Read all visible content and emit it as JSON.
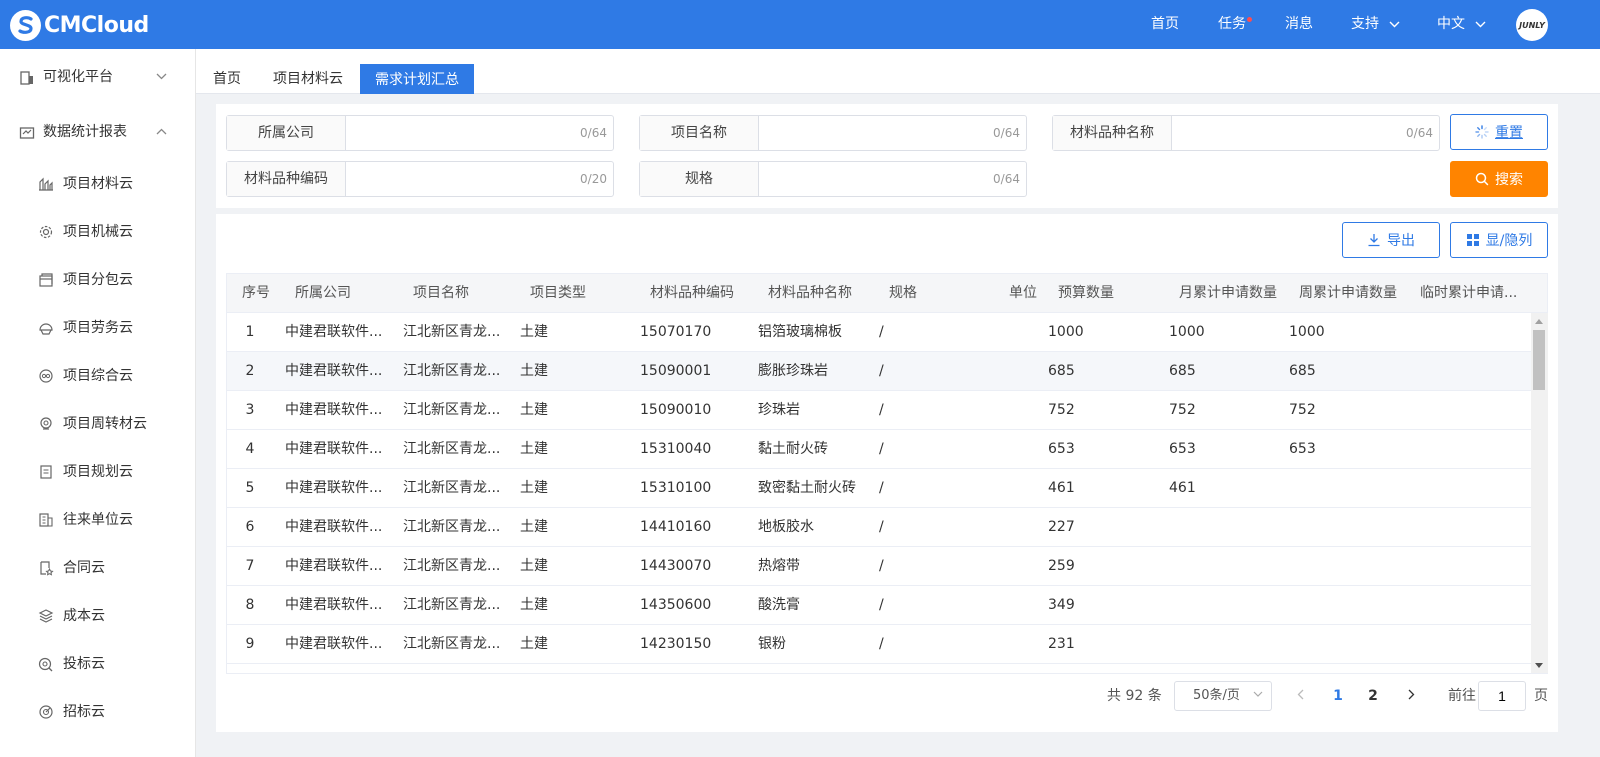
{
  "brand": {
    "logo_text": "CMCloud"
  },
  "header": {
    "nav": [
      "首页",
      "任务",
      "消息",
      "支持",
      "中文"
    ],
    "avatar_text": "JUNLY"
  },
  "sidebar": {
    "groups": [
      {
        "label": "可视化平台",
        "icon": "building-icon",
        "expanded": false
      },
      {
        "label": "数据统计报表",
        "icon": "report-icon",
        "expanded": true
      }
    ],
    "items": [
      {
        "label": "项目材料云",
        "icon": "chart-icon"
      },
      {
        "label": "项目机械云",
        "icon": "gear-icon"
      },
      {
        "label": "项目分包云",
        "icon": "package-icon"
      },
      {
        "label": "项目劳务云",
        "icon": "helmet-icon"
      },
      {
        "label": "项目综合云",
        "icon": "coins-icon"
      },
      {
        "label": "项目周转材云",
        "icon": "cycle-icon"
      },
      {
        "label": "项目规划云",
        "icon": "plan-icon"
      },
      {
        "label": "往来单位云",
        "icon": "office-icon"
      },
      {
        "label": "合同云",
        "icon": "contract-icon"
      },
      {
        "label": "成本云",
        "icon": "layers-icon"
      },
      {
        "label": "投标云",
        "icon": "bid-icon"
      },
      {
        "label": "招标云",
        "icon": "target-icon"
      }
    ]
  },
  "tabs": [
    {
      "label": "首页",
      "active": false
    },
    {
      "label": "项目材料云",
      "active": false
    },
    {
      "label": "需求计划汇总",
      "active": true
    }
  ],
  "filters": {
    "fields": [
      {
        "label": "所属公司",
        "value": "",
        "count": "0/64"
      },
      {
        "label": "项目名称",
        "value": "",
        "count": "0/64"
      },
      {
        "label": "材料品种名称",
        "value": "",
        "count": "0/64"
      },
      {
        "label": "材料品种编码",
        "value": "",
        "count": "0/20"
      },
      {
        "label": "规格",
        "value": "",
        "count": "0/64"
      }
    ],
    "reset_label": "重置",
    "search_label": "搜索"
  },
  "toolbar": {
    "export_label": "导出",
    "columns_label": "显/隐列"
  },
  "table": {
    "columns": [
      "序号",
      "所属公司",
      "项目名称",
      "项目类型",
      "材料品种编码",
      "材料品种名称",
      "规格",
      "单位",
      "预算数量",
      "月累计申请数量",
      "周累计申请数量",
      "临时累计申请..."
    ],
    "rows": [
      [
        "1",
        "中建君联软件...",
        "江北新区青龙...",
        "土建",
        "15070170",
        "铝箔玻璃棉板",
        "/",
        "",
        "1000",
        "1000",
        "1000",
        ""
      ],
      [
        "2",
        "中建君联软件...",
        "江北新区青龙...",
        "土建",
        "15090001",
        "膨胀珍珠岩",
        "/",
        "",
        "685",
        "685",
        "685",
        ""
      ],
      [
        "3",
        "中建君联软件...",
        "江北新区青龙...",
        "土建",
        "15090010",
        "珍珠岩",
        "/",
        "",
        "752",
        "752",
        "752",
        ""
      ],
      [
        "4",
        "中建君联软件...",
        "江北新区青龙...",
        "土建",
        "15310040",
        "黏土耐火砖",
        "/",
        "",
        "653",
        "653",
        "653",
        ""
      ],
      [
        "5",
        "中建君联软件...",
        "江北新区青龙...",
        "土建",
        "15310100",
        "致密黏土耐火砖",
        "/",
        "",
        "461",
        "461",
        "",
        ""
      ],
      [
        "6",
        "中建君联软件...",
        "江北新区青龙...",
        "土建",
        "14410160",
        "地板胶水",
        "/",
        "",
        "227",
        "",
        "",
        ""
      ],
      [
        "7",
        "中建君联软件...",
        "江北新区青龙...",
        "土建",
        "14430070",
        "热熔带",
        "/",
        "",
        "259",
        "",
        "",
        ""
      ],
      [
        "8",
        "中建君联软件...",
        "江北新区青龙...",
        "土建",
        "14350600",
        "酸洗膏",
        "/",
        "",
        "349",
        "",
        "",
        ""
      ],
      [
        "9",
        "中建君联软件...",
        "江北新区青龙...",
        "土建",
        "14230150",
        "银粉",
        "/",
        "",
        "231",
        "",
        "",
        ""
      ]
    ]
  },
  "pagination": {
    "total_text": "共 92 条",
    "page_size": "50条/页",
    "pages": [
      "1",
      "2"
    ],
    "current": "1",
    "goto_label": "前往",
    "goto_value": "1",
    "page_suffix": "页"
  },
  "colors": {
    "primary": "#2f7ae5",
    "orange": "#ff8400",
    "notice_dot": "#ff4d4f"
  }
}
